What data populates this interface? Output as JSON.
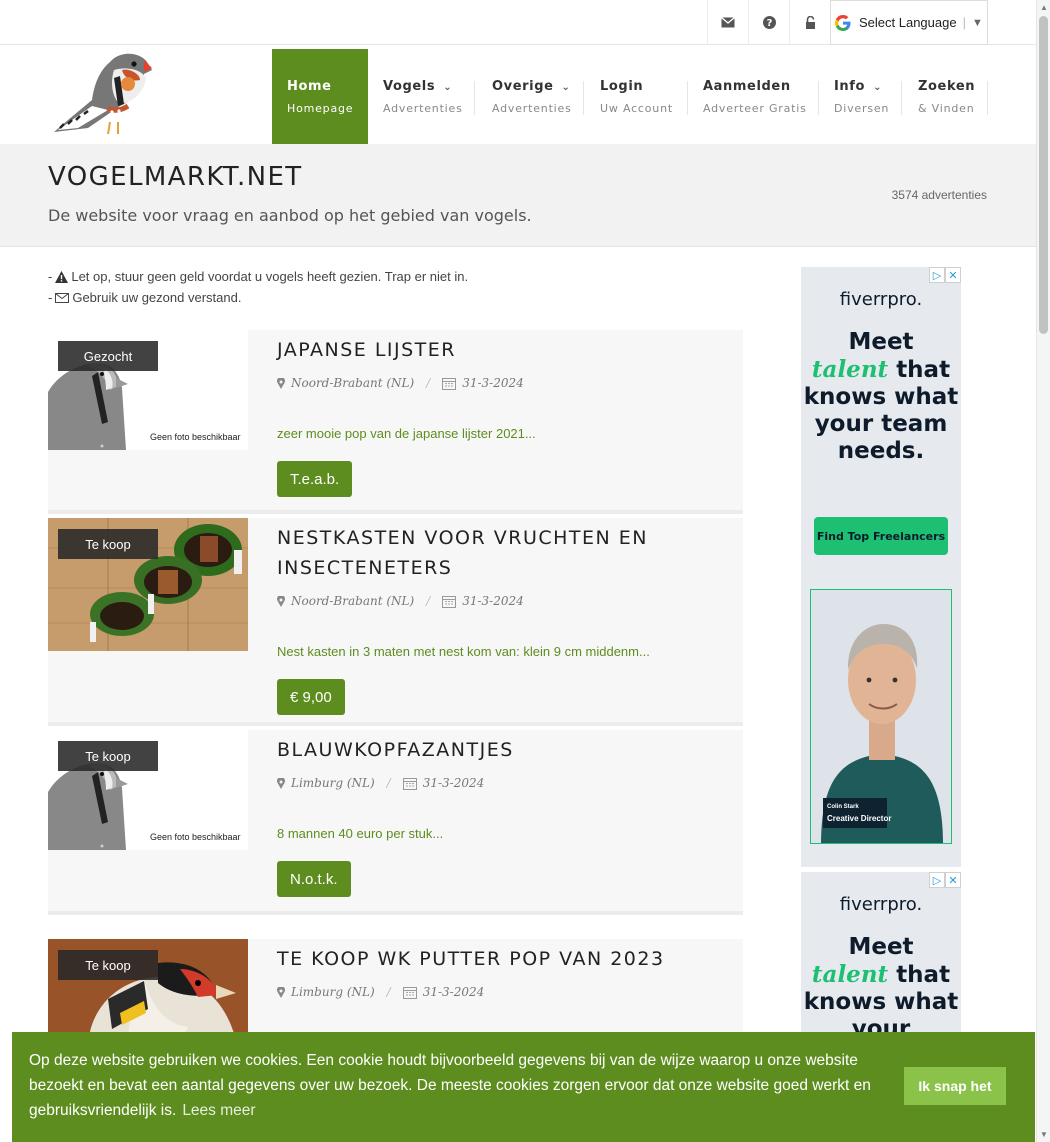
{
  "topbar": {
    "icons": [
      "envelope-icon",
      "question-icon",
      "lock-icon"
    ],
    "language": {
      "label": "Select Language",
      "arrow": "▼"
    }
  },
  "nav": {
    "items": [
      {
        "title": "Home",
        "subtitle": "Homepage",
        "active": true
      },
      {
        "title": "Vogels",
        "subtitle": "Advertenties",
        "dropdown": true
      },
      {
        "title": "Overige",
        "subtitle": "Advertenties",
        "dropdown": true
      },
      {
        "title": "Login",
        "subtitle": "Uw Account"
      },
      {
        "title": "Aanmelden",
        "subtitle": "Adverteer Gratis"
      },
      {
        "title": "Info",
        "subtitle": "Diversen",
        "dropdown": true
      },
      {
        "title": "Zoeken",
        "subtitle": "& Vinden"
      }
    ]
  },
  "hero": {
    "title": "VOGELMARKT.NET",
    "subtitle": "De website voor vraag en aanbod op het gebied van vogels.",
    "count": "3574 advertenties"
  },
  "notices": [
    {
      "prefix": "-",
      "icon": "warning-icon",
      "text": "Let op, stuur geen geld voordat u vogels heeft gezien. Trap er niet in."
    },
    {
      "prefix": "-",
      "icon": "envelope-icon",
      "text": "Gebruik uw gezond verstand."
    }
  ],
  "listings": [
    {
      "badge": "Gezocht",
      "title": "JAPANSE LIJSTER",
      "region": "Noord-Brabant (NL)",
      "date": "31-3-2024",
      "desc": "zeer mooie pop van de japanse lijster 2021...",
      "price": "T.e.a.b.",
      "photo": "placeholder",
      "placeholder_text": "Geen foto beschikbaar"
    },
    {
      "badge": "Te koop",
      "title": "NESTKASTEN VOOR VRUCHTEN EN INSECTENETERS",
      "region": "Noord-Brabant (NL)",
      "date": "31-3-2024",
      "desc": "Nest kasten in 3 maten met nest kom van: klein 9 cm middenm...",
      "price": "€ 9,00",
      "photo": "nestkast"
    },
    {
      "badge": "Te koop",
      "title": "BLAUWKOPFAZANTJES",
      "region": "Limburg (NL)",
      "date": "31-3-2024",
      "desc": "8 mannen 40 euro per stuk...",
      "price": "N.o.t.k.",
      "photo": "placeholder",
      "placeholder_text": "Geen foto beschikbaar"
    },
    {
      "badge": "Te koop",
      "title": "TE KOOP WK PUTTER POP VAN 2023",
      "region": "Limburg (NL)",
      "date": "31-3-2024",
      "photo": "putter"
    }
  ],
  "ads": [
    {
      "brand": "fiverr",
      "brand_suffix": "pro.",
      "headline_1": "Meet",
      "headline_accent": "talent",
      "headline_2": "that knows what your team needs.",
      "cta": "Find Top Freelancers",
      "person_name": "Colin Stark",
      "person_role": "Creative Director"
    },
    {
      "brand": "fiverr",
      "brand_suffix": "pro.",
      "headline_1": "Meet",
      "headline_accent": "talent",
      "headline_2": "that knows what your"
    }
  ],
  "cookie": {
    "message": "Op deze website gebruiken we cookies. Een cookie houdt bijvoorbeeld gegevens bij van de wijze waarop u onze website bezoekt en bevat een aantal gegevens over uw bezoek. De meeste cookies zorgen ervoor dat onze website goed werkt en gebruiksvriendelijk is.",
    "more": "Lees meer",
    "button": "Ik snap het"
  },
  "colors": {
    "accent": "#5e8d1f",
    "fiverr_green": "#1dbf73"
  }
}
